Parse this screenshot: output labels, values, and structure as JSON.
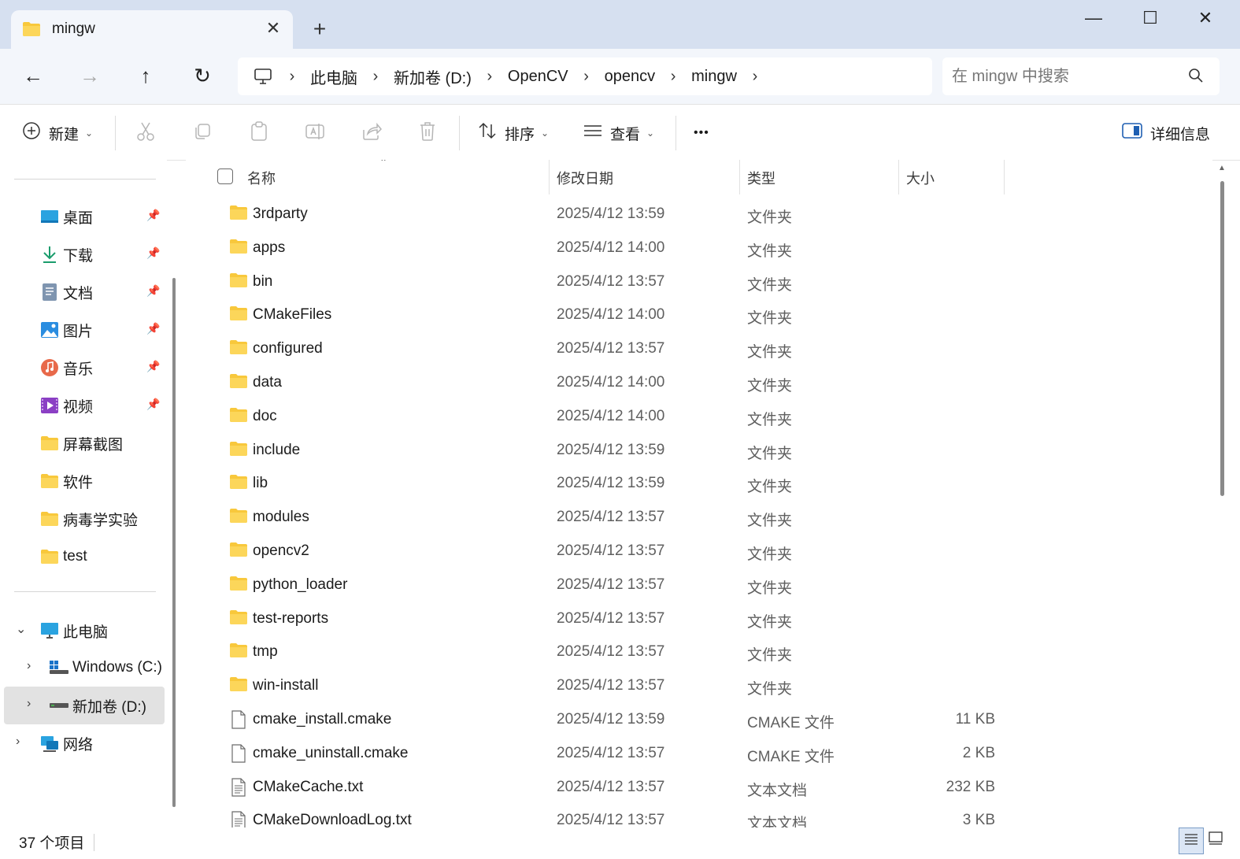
{
  "window": {
    "tab_title": "mingw",
    "tab_close": "✕",
    "new_tab": "+",
    "minimize": "—",
    "maximize": "☐",
    "close": "✕"
  },
  "nav": {
    "back": "←",
    "forward": "→",
    "up": "↑",
    "refresh": "↻"
  },
  "breadcrumb": [
    "此电脑",
    "新加卷 (D:)",
    "OpenCV",
    "opencv",
    "mingw"
  ],
  "search": {
    "placeholder": "在 mingw 中搜索"
  },
  "toolbar": {
    "new_label": "新建",
    "sort_label": "排序",
    "view_label": "查看",
    "more": "•••",
    "details_label": "详细信息"
  },
  "sidebar": {
    "quick_access": [
      {
        "label": "桌面",
        "icon": "desktop-icon",
        "pinned": true
      },
      {
        "label": "下载",
        "icon": "download-icon",
        "pinned": true
      },
      {
        "label": "文档",
        "icon": "document-icon",
        "pinned": true
      },
      {
        "label": "图片",
        "icon": "pictures-icon",
        "pinned": true
      },
      {
        "label": "音乐",
        "icon": "music-icon",
        "pinned": true
      },
      {
        "label": "视频",
        "icon": "video-icon",
        "pinned": true
      },
      {
        "label": "屏幕截图",
        "icon": "folder-icon",
        "pinned": false
      },
      {
        "label": "软件",
        "icon": "folder-icon",
        "pinned": false
      },
      {
        "label": "病毒学实验",
        "icon": "folder-icon",
        "pinned": false
      },
      {
        "label": "test",
        "icon": "folder-icon",
        "pinned": false
      }
    ],
    "this_pc": "此电脑",
    "drives": [
      {
        "label": "Windows (C:)",
        "icon": "windows-drive-icon"
      },
      {
        "label": "新加卷 (D:)",
        "icon": "drive-icon",
        "selected": true
      }
    ],
    "network": "网络"
  },
  "columns": {
    "name": "名称",
    "modified": "修改日期",
    "type": "类型",
    "size": "大小"
  },
  "files": [
    {
      "name": "3rdparty",
      "date": "2025/4/12 13:59",
      "type": "文件夹",
      "size": "",
      "kind": "folder"
    },
    {
      "name": "apps",
      "date": "2025/4/12 14:00",
      "type": "文件夹",
      "size": "",
      "kind": "folder"
    },
    {
      "name": "bin",
      "date": "2025/4/12 13:57",
      "type": "文件夹",
      "size": "",
      "kind": "folder"
    },
    {
      "name": "CMakeFiles",
      "date": "2025/4/12 14:00",
      "type": "文件夹",
      "size": "",
      "kind": "folder"
    },
    {
      "name": "configured",
      "date": "2025/4/12 13:57",
      "type": "文件夹",
      "size": "",
      "kind": "folder"
    },
    {
      "name": "data",
      "date": "2025/4/12 14:00",
      "type": "文件夹",
      "size": "",
      "kind": "folder"
    },
    {
      "name": "doc",
      "date": "2025/4/12 14:00",
      "type": "文件夹",
      "size": "",
      "kind": "folder"
    },
    {
      "name": "include",
      "date": "2025/4/12 13:59",
      "type": "文件夹",
      "size": "",
      "kind": "folder"
    },
    {
      "name": "lib",
      "date": "2025/4/12 13:59",
      "type": "文件夹",
      "size": "",
      "kind": "folder"
    },
    {
      "name": "modules",
      "date": "2025/4/12 13:57",
      "type": "文件夹",
      "size": "",
      "kind": "folder"
    },
    {
      "name": "opencv2",
      "date": "2025/4/12 13:57",
      "type": "文件夹",
      "size": "",
      "kind": "folder"
    },
    {
      "name": "python_loader",
      "date": "2025/4/12 13:57",
      "type": "文件夹",
      "size": "",
      "kind": "folder"
    },
    {
      "name": "test-reports",
      "date": "2025/4/12 13:57",
      "type": "文件夹",
      "size": "",
      "kind": "folder"
    },
    {
      "name": "tmp",
      "date": "2025/4/12 13:57",
      "type": "文件夹",
      "size": "",
      "kind": "folder"
    },
    {
      "name": "win-install",
      "date": "2025/4/12 13:57",
      "type": "文件夹",
      "size": "",
      "kind": "folder"
    },
    {
      "name": "cmake_install.cmake",
      "date": "2025/4/12 13:59",
      "type": "CMAKE 文件",
      "size": "11 KB",
      "kind": "file"
    },
    {
      "name": "cmake_uninstall.cmake",
      "date": "2025/4/12 13:57",
      "type": "CMAKE 文件",
      "size": "2 KB",
      "kind": "file"
    },
    {
      "name": "CMakeCache.txt",
      "date": "2025/4/12 13:57",
      "type": "文本文档",
      "size": "232 KB",
      "kind": "text"
    },
    {
      "name": "CMakeDownloadLog.txt",
      "date": "2025/4/12 13:57",
      "type": "文本文档",
      "size": "3 KB",
      "kind": "text"
    }
  ],
  "status": {
    "item_count": "37 个项目"
  },
  "colors": {
    "titlebar": "#d6e0f0",
    "addressbar": "#f3f6fb",
    "folder_yellow": "#f8c83c",
    "accent": "#0067c0"
  }
}
